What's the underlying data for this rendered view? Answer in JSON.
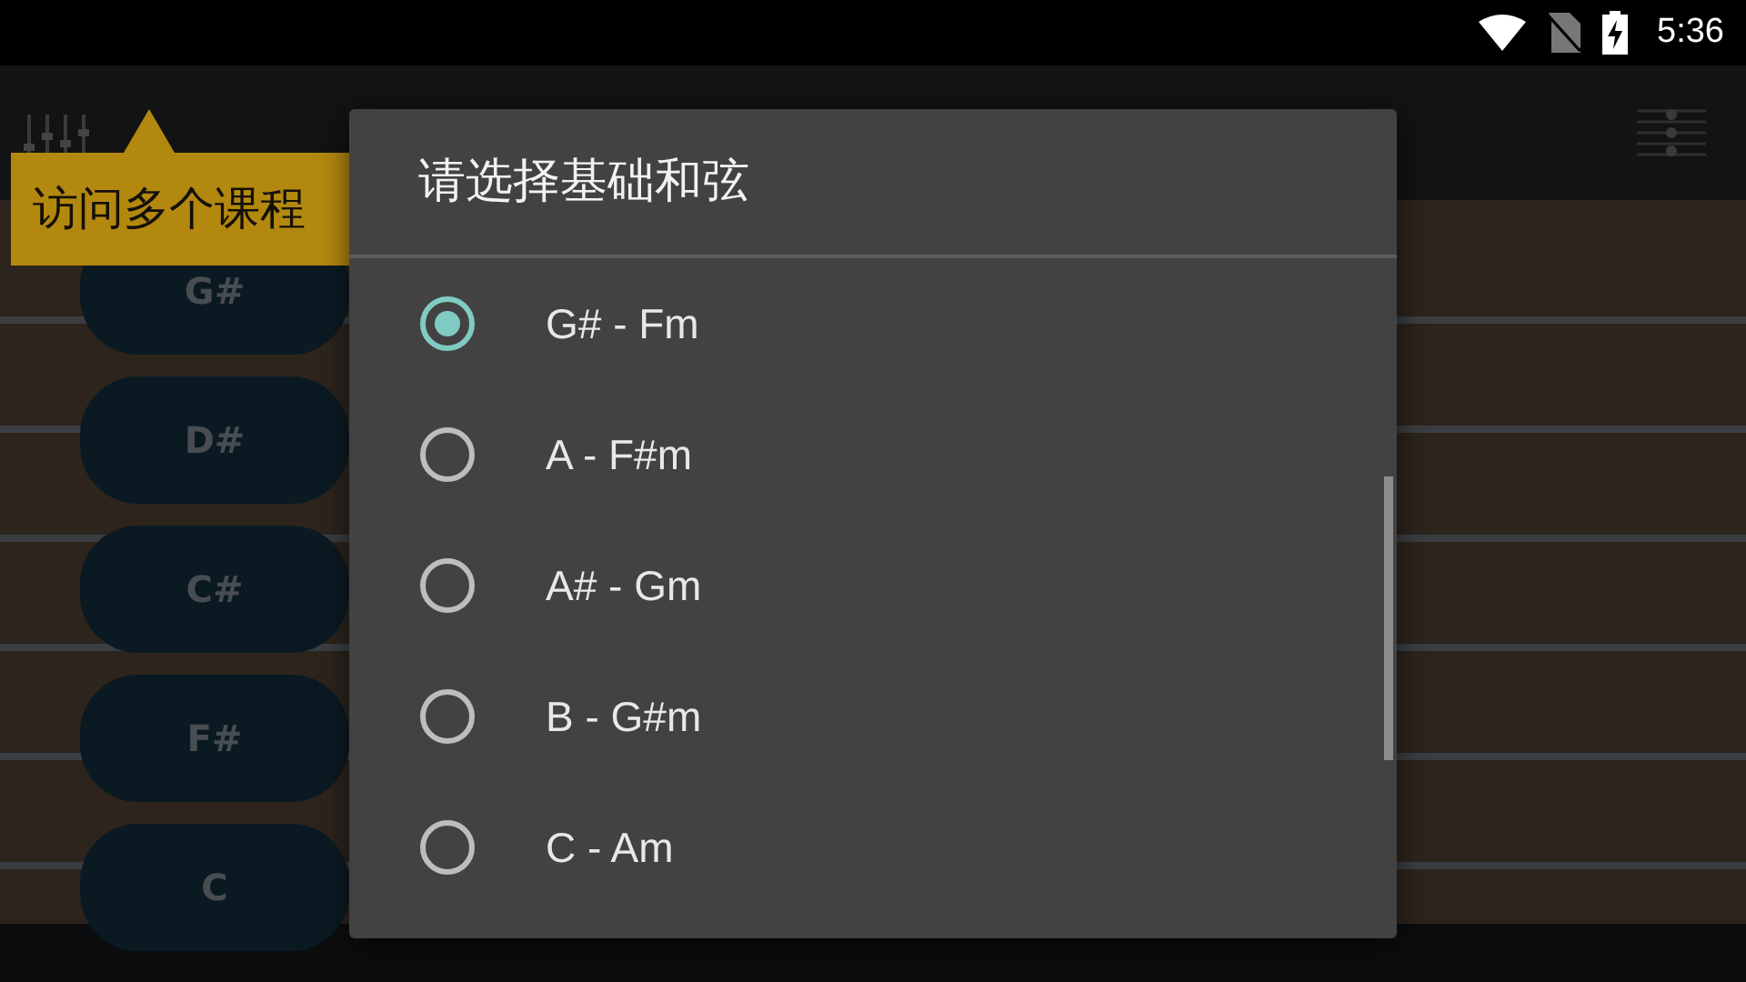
{
  "status_bar": {
    "time": "5:36"
  },
  "tooltip": {
    "text": "访问多个课程"
  },
  "chord_buttons": [
    {
      "label": "G#"
    },
    {
      "label": "D#"
    },
    {
      "label": "C#"
    },
    {
      "label": "F#"
    },
    {
      "label": "C"
    }
  ],
  "dialog": {
    "title": "请选择基础和弦",
    "options": [
      {
        "label": "G# - Fm",
        "selected": true
      },
      {
        "label": "A - F#m",
        "selected": false
      },
      {
        "label": "A# - Gm",
        "selected": false
      },
      {
        "label": "B - G#m",
        "selected": false
      },
      {
        "label": "C - Am",
        "selected": false
      }
    ]
  }
}
